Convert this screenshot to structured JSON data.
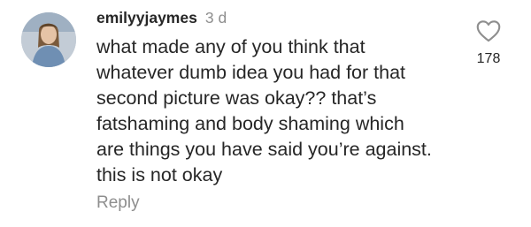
{
  "comment": {
    "username": "emilyyjaymes",
    "timestamp": "3 d",
    "text": "what made any of you think that\nwhatever dumb idea you had for that\nsecond picture was okay?? that’s\nfatshaming and body shaming which\nare things you have said you’re against.\nthis is not okay",
    "reply_label": "Reply",
    "like_count": "178",
    "avatar_icon": "user-avatar",
    "like_icon": "heart-outline-icon"
  }
}
